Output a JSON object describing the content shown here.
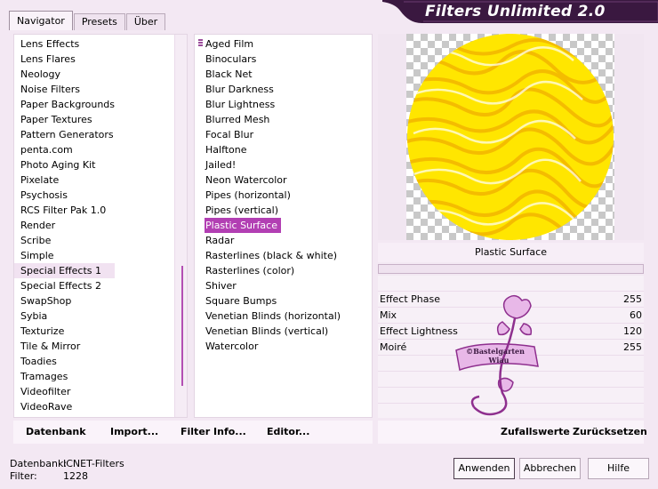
{
  "tabs": [
    "Navigator",
    "Presets",
    "Über"
  ],
  "app_title": "Filters Unlimited 2.0",
  "categories": [
    "Lens Effects",
    "Lens Flares",
    "Neology",
    "Noise Filters",
    "Paper Backgrounds",
    "Paper Textures",
    "Pattern Generators",
    "penta.com",
    "Photo Aging Kit",
    "Pixelate",
    "Psychosis",
    "RCS Filter Pak 1.0",
    "Render",
    "Scribe",
    "Simple",
    "Special Effects 1",
    "Special Effects 2",
    "SwapShop",
    "Sybia",
    "Texturize",
    "Tile & Mirror",
    "Toadies",
    "Tramages",
    "Videofilter",
    "VideoRave"
  ],
  "selected_category": "Special Effects 1",
  "filters": [
    "Aged Film",
    "Binoculars",
    "Black Net",
    "Blur Darkness",
    "Blur Lightness",
    "Blurred Mesh",
    "Focal Blur",
    "Halftone",
    "Jailed!",
    "Neon Watercolor",
    "Pipes (horizontal)",
    "Pipes (vertical)",
    "Plastic Surface",
    "Radar",
    "Rasterlines (black & white)",
    "Rasterlines (color)",
    "Shiver",
    "Square Bumps",
    "Venetian Blinds (horizontal)",
    "Venetian Blinds (vertical)",
    "Watercolor"
  ],
  "selected_filter": "Plastic Surface",
  "preview_label": "Plastic Surface",
  "params": [
    {
      "label": "Effect Phase",
      "value": "255"
    },
    {
      "label": "Mix",
      "value": "60"
    },
    {
      "label": "Effect Lightness",
      "value": "120"
    },
    {
      "label": "Moiré",
      "value": "255"
    }
  ],
  "buttons": {
    "datenbank": "Datenbank",
    "import": "Import...",
    "filter_info": "Filter Info...",
    "editor": "Editor...",
    "zufallswerte": "Zufallswerte",
    "zuruecksetzen": "Zurücksetzen",
    "anwenden": "Anwenden",
    "abbrechen": "Abbrechen",
    "hilfe": "Hilfe"
  },
  "status": {
    "datenbank_label": "Datenbank:",
    "datenbank_value": "ICNET-Filters",
    "filter_label": "Filter:",
    "filter_value": "1228"
  },
  "watermark": "©Bastelgarten Wiau",
  "colors": {
    "accent": "#b23fb3",
    "background": "#f3e8f3",
    "banner": "#3a1840"
  }
}
